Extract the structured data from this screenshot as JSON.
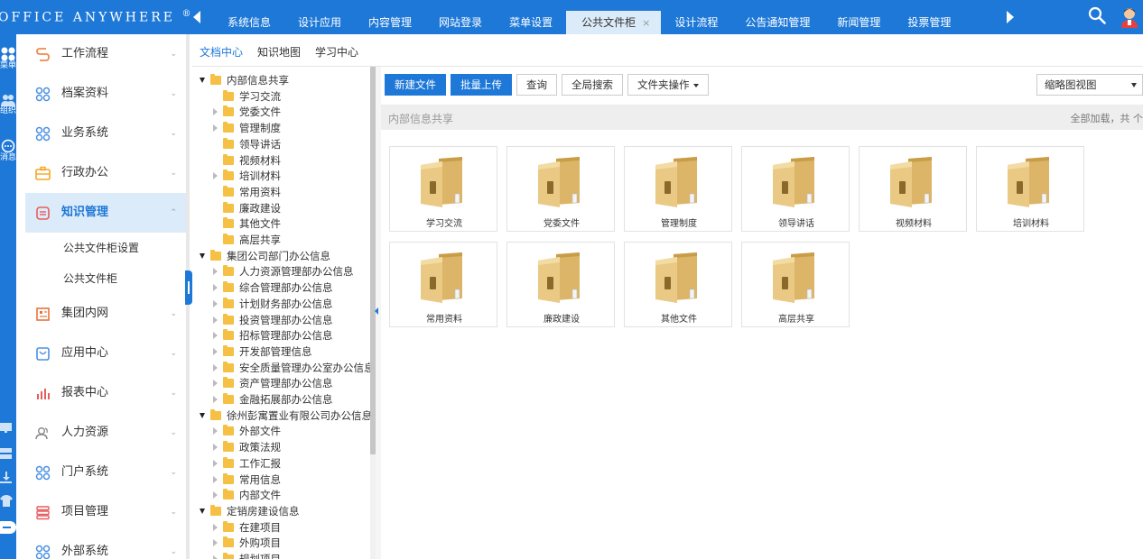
{
  "app": {
    "logo_text": "OFFICE ANYWHERE",
    "logo_mark": "®"
  },
  "top_tabs": [
    {
      "label": "系统信息"
    },
    {
      "label": "设计应用"
    },
    {
      "label": "内容管理"
    },
    {
      "label": "网站登录"
    },
    {
      "label": "菜单设置"
    },
    {
      "label": "公共文件柜",
      "active": true,
      "close": "×"
    },
    {
      "label": "设计流程"
    },
    {
      "label": "公告通知管理"
    },
    {
      "label": "新闻管理"
    },
    {
      "label": "投票管理"
    }
  ],
  "icon_strip": [
    {
      "label": "菜单",
      "icon": "grid-icon"
    },
    {
      "label": "组织",
      "icon": "people-icon"
    },
    {
      "label": "消息",
      "icon": "chat-icon"
    }
  ],
  "module_menu": [
    {
      "label": "工作流程",
      "icon": "workflow-icon",
      "chevron": "⌄"
    },
    {
      "label": "档案资料",
      "icon": "archive-icon",
      "chevron": "⌄"
    },
    {
      "label": "业务系统",
      "icon": "business-icon",
      "chevron": "⌄"
    },
    {
      "label": "行政办公",
      "icon": "briefcase-icon",
      "chevron": "⌄"
    },
    {
      "label": "知识管理",
      "icon": "knowledge-icon",
      "chevron": "⌃",
      "active": true
    },
    {
      "label": "集团内网",
      "icon": "intranet-icon",
      "chevron": "⌄"
    },
    {
      "label": "应用中心",
      "icon": "app-center-icon",
      "chevron": "⌄"
    },
    {
      "label": "报表中心",
      "icon": "report-icon",
      "chevron": "⌄"
    },
    {
      "label": "人力资源",
      "icon": "hr-icon",
      "chevron": "⌄"
    },
    {
      "label": "门户系统",
      "icon": "portal-icon",
      "chevron": "⌄"
    },
    {
      "label": "项目管理",
      "icon": "project-icon",
      "chevron": "⌄"
    },
    {
      "label": "外部系统",
      "icon": "external-icon",
      "chevron": "⌄"
    }
  ],
  "module_submenu": [
    "公共文件柜设置",
    "公共文件柜"
  ],
  "sub_nav": [
    "文档中心",
    "知识地图",
    "学习中心"
  ],
  "tree": [
    {
      "label": "内部信息共享",
      "level": 0,
      "state": "open"
    },
    {
      "label": "学习交流",
      "level": 1,
      "state": "leaf"
    },
    {
      "label": "党委文件",
      "level": 1,
      "state": "closed"
    },
    {
      "label": "管理制度",
      "level": 1,
      "state": "closed"
    },
    {
      "label": "领导讲话",
      "level": 1,
      "state": "leaf"
    },
    {
      "label": "视频材料",
      "level": 1,
      "state": "leaf"
    },
    {
      "label": "培训材料",
      "level": 1,
      "state": "closed"
    },
    {
      "label": "常用资料",
      "level": 1,
      "state": "leaf"
    },
    {
      "label": "廉政建设",
      "level": 1,
      "state": "leaf"
    },
    {
      "label": "其他文件",
      "level": 1,
      "state": "leaf"
    },
    {
      "label": "高层共享",
      "level": 1,
      "state": "leaf"
    },
    {
      "label": "集团公司部门办公信息",
      "level": 0,
      "state": "open"
    },
    {
      "label": "人力资源管理部办公信息",
      "level": 1,
      "state": "closed"
    },
    {
      "label": "综合管理部办公信息",
      "level": 1,
      "state": "closed"
    },
    {
      "label": "计划财务部办公信息",
      "level": 1,
      "state": "closed"
    },
    {
      "label": "投资管理部办公信息",
      "level": 1,
      "state": "closed"
    },
    {
      "label": "招标管理部办公信息",
      "level": 1,
      "state": "closed"
    },
    {
      "label": "开发部管理信息",
      "level": 1,
      "state": "closed"
    },
    {
      "label": "安全质量管理办公室办公信息",
      "level": 1,
      "state": "closed"
    },
    {
      "label": "资产管理部办公信息",
      "level": 1,
      "state": "closed"
    },
    {
      "label": "金融拓展部办公信息",
      "level": 1,
      "state": "closed"
    },
    {
      "label": "徐州彭寓置业有限公司办公信息",
      "level": 0,
      "state": "open"
    },
    {
      "label": "外部文件",
      "level": 1,
      "state": "closed"
    },
    {
      "label": "政策法规",
      "level": 1,
      "state": "closed"
    },
    {
      "label": "工作汇报",
      "level": 1,
      "state": "closed"
    },
    {
      "label": "常用信息",
      "level": 1,
      "state": "closed"
    },
    {
      "label": "内部文件",
      "level": 1,
      "state": "closed"
    },
    {
      "label": "定销房建设信息",
      "level": 0,
      "state": "open"
    },
    {
      "label": "在建项目",
      "level": 1,
      "state": "closed"
    },
    {
      "label": "外购项目",
      "level": 1,
      "state": "closed"
    },
    {
      "label": "规划项目",
      "level": 1,
      "state": "closed"
    }
  ],
  "toolbar": {
    "new_file": "新建文件",
    "batch_upload": "批量上传",
    "query": "查询",
    "global_search": "全局搜索",
    "folder_ops": "文件夹操作"
  },
  "view_select": {
    "value": "缩略图视图"
  },
  "path": {
    "current": "内部信息共享",
    "status": "全部加载，共 个"
  },
  "folders": [
    "学习交流",
    "党委文件",
    "管理制度",
    "领导讲话",
    "视频材料",
    "培训材料",
    "常用资料",
    "廉政建设",
    "其他文件",
    "高层共享"
  ],
  "colors": {
    "brand_blue": "#1e78d7",
    "active_tab_bg": "#dcebf9",
    "folder_yellow": "#f5c044"
  }
}
